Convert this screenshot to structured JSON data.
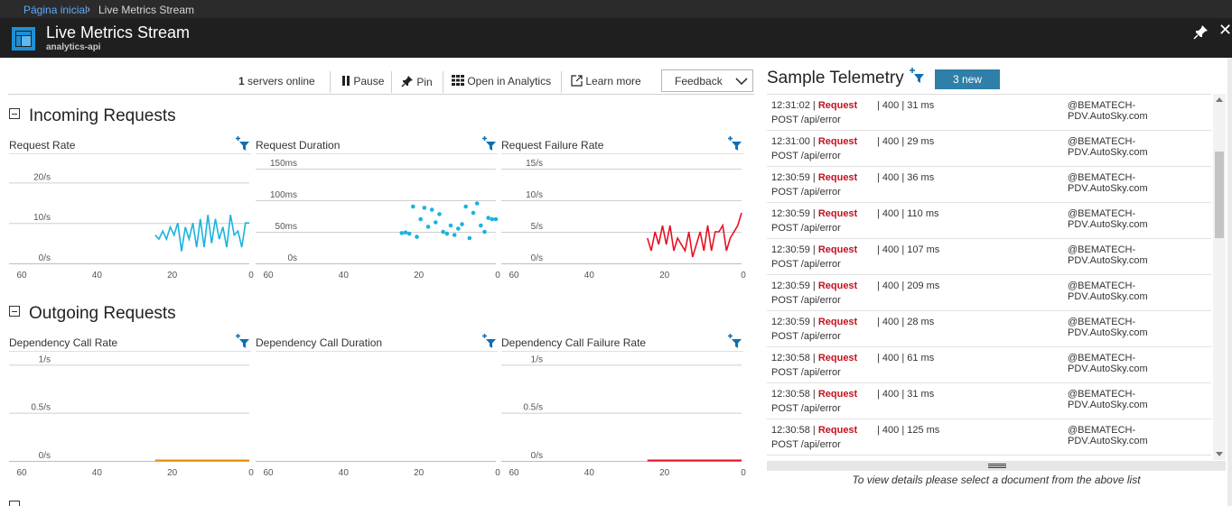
{
  "breadcrumb": {
    "home": "Página inicial",
    "separator": "›",
    "current": "Live Metrics Stream"
  },
  "window": {
    "title": "Live Metrics Stream",
    "subtitle": "analytics-api",
    "close_label": "✕"
  },
  "toolbar": {
    "servers_count": "1",
    "servers_label": "servers online",
    "pause_label": "Pause",
    "pin_label": "Pin",
    "analytics_label": "Open in Analytics",
    "learn_label": "Learn more",
    "feedback_label": "Feedback"
  },
  "sections": {
    "incoming": "Incoming Requests",
    "outgoing": "Outgoing Requests"
  },
  "colors": {
    "cyan": "#1ab3de",
    "red": "#e81123",
    "orange": "#f08a00",
    "badge": "#2f7fa8",
    "filter": "#0f6fb0"
  },
  "chart_data": [
    {
      "id": "request-rate",
      "type": "line",
      "title": "Request Rate",
      "x_ticks": [
        60,
        40,
        20,
        0
      ],
      "y_ticks": [
        "0/s",
        "10/s",
        "20/s"
      ],
      "ylim": [
        0,
        25
      ],
      "color": "#1ab3de",
      "x": [
        25,
        24,
        23,
        22,
        21,
        20,
        19,
        18,
        17,
        16,
        15,
        14,
        13,
        12,
        11,
        10,
        9,
        8,
        7,
        6,
        5,
        4,
        3,
        2,
        1,
        0
      ],
      "values": [
        7,
        6,
        8,
        6,
        9,
        7,
        10,
        3,
        9,
        6,
        10,
        4,
        11,
        4,
        12,
        5,
        11,
        6,
        9,
        4,
        12,
        7,
        8,
        4,
        10,
        10
      ]
    },
    {
      "id": "request-duration",
      "type": "scatter",
      "title": "Request Duration",
      "x_ticks": [
        60,
        40,
        20,
        0
      ],
      "y_ticks": [
        "0s",
        "50ms",
        "100ms",
        "150ms"
      ],
      "ylim": [
        0,
        160
      ],
      "color": "#1ab3de",
      "x": [
        25,
        24,
        23,
        22,
        21,
        20,
        19,
        18,
        17,
        16,
        15,
        14,
        13,
        12,
        11,
        10,
        9,
        8,
        7,
        6,
        5,
        4,
        3,
        2,
        1,
        0
      ],
      "values": [
        48,
        49,
        47,
        90,
        42,
        70,
        88,
        58,
        85,
        65,
        78,
        50,
        47,
        60,
        45,
        55,
        62,
        90,
        40,
        80,
        95,
        60,
        50,
        72,
        70,
        70
      ]
    },
    {
      "id": "request-failure-rate",
      "type": "line",
      "title": "Request Failure Rate",
      "x_ticks": [
        60,
        40,
        20,
        0
      ],
      "y_ticks": [
        "0/s",
        "5/s",
        "10/s",
        "15/s"
      ],
      "ylim": [
        0,
        16
      ],
      "color": "#e81123",
      "x": [
        25,
        24,
        23,
        22,
        21,
        20,
        19,
        18,
        17,
        16,
        15,
        14,
        13,
        12,
        11,
        10,
        9,
        8,
        7,
        6,
        5,
        4,
        3,
        2,
        1,
        0
      ],
      "values": [
        4,
        2,
        5,
        3,
        6,
        3,
        6,
        2,
        4,
        3,
        2,
        5,
        1,
        3,
        5,
        2,
        6,
        2,
        5,
        5,
        6,
        2,
        4,
        5,
        6,
        8
      ]
    },
    {
      "id": "dependency-call-rate",
      "type": "line",
      "title": "Dependency Call Rate",
      "x_ticks": [
        60,
        40,
        20,
        0
      ],
      "y_ticks": [
        "0/s",
        "0.5/s",
        "1/s"
      ],
      "ylim": [
        0,
        1.05
      ],
      "color": "#f08a00",
      "x": [
        25,
        0
      ],
      "values": [
        0,
        0
      ]
    },
    {
      "id": "dependency-call-duration",
      "type": "line",
      "title": "Dependency Call Duration",
      "x_ticks": [
        60,
        40,
        20,
        0
      ],
      "y_ticks": [],
      "ylim": [
        0,
        1
      ],
      "color": "#1ab3de",
      "x": [],
      "values": []
    },
    {
      "id": "dependency-call-failure-rate",
      "type": "line",
      "title": "Dependency Call Failure Rate",
      "x_ticks": [
        60,
        40,
        20,
        0
      ],
      "y_ticks": [
        "0/s",
        "0.5/s",
        "1/s"
      ],
      "ylim": [
        0,
        1.05
      ],
      "color": "#e81123",
      "x": [
        25,
        0
      ],
      "values": [
        0,
        0
      ]
    }
  ],
  "telemetry": {
    "title": "Sample Telemetry",
    "new_badge": "3 new",
    "items": [
      {
        "time": "12:31:02",
        "kind": "Request",
        "status": "| 400 | 31 ms",
        "host": "@BEMATECH-PDV.AutoSky.com",
        "path": "POST /api/error"
      },
      {
        "time": "12:31:00",
        "kind": "Request",
        "status": "| 400 | 29 ms",
        "host": "@BEMATECH-PDV.AutoSky.com",
        "path": "POST /api/error"
      },
      {
        "time": "12:30:59",
        "kind": "Request",
        "status": "| 400 | 36 ms",
        "host": "@BEMATECH-PDV.AutoSky.com",
        "path": "POST /api/error"
      },
      {
        "time": "12:30:59",
        "kind": "Request",
        "status": "| 400 | 110 ms",
        "host": "@BEMATECH-PDV.AutoSky.com",
        "path": "POST /api/error"
      },
      {
        "time": "12:30:59",
        "kind": "Request",
        "status": "| 400 | 107 ms",
        "host": "@BEMATECH-PDV.AutoSky.com",
        "path": "POST /api/error"
      },
      {
        "time": "12:30:59",
        "kind": "Request",
        "status": "| 400 | 209 ms",
        "host": "@BEMATECH-PDV.AutoSky.com",
        "path": "POST /api/error"
      },
      {
        "time": "12:30:59",
        "kind": "Request",
        "status": "| 400 | 28 ms",
        "host": "@BEMATECH-PDV.AutoSky.com",
        "path": "POST /api/error"
      },
      {
        "time": "12:30:58",
        "kind": "Request",
        "status": "| 400 | 61 ms",
        "host": "@BEMATECH-PDV.AutoSky.com",
        "path": "POST /api/error"
      },
      {
        "time": "12:30:58",
        "kind": "Request",
        "status": "| 400 | 31 ms",
        "host": "@BEMATECH-PDV.AutoSky.com",
        "path": "POST /api/error"
      },
      {
        "time": "12:30:58",
        "kind": "Request",
        "status": "| 400 | 125 ms",
        "host": "@BEMATECH-PDV.AutoSky.com",
        "path": "POST /api/error"
      }
    ],
    "detail_hint": "To view details please select a document from the above list"
  }
}
